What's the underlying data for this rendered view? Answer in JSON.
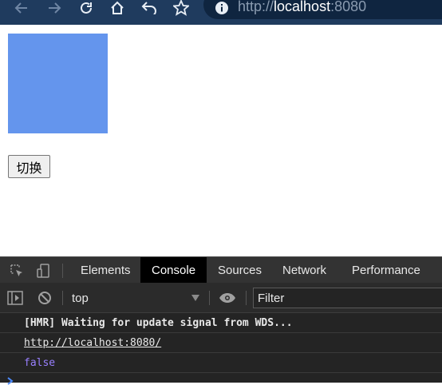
{
  "browser": {
    "url_scheme": "http://",
    "url_host": "localhost",
    "url_port": ":8080",
    "icons": [
      "back-arrow-icon",
      "forward-arrow-icon",
      "reload-icon",
      "home-icon",
      "undo-icon",
      "star-icon",
      "info-icon"
    ]
  },
  "page": {
    "box_color": "#6495ed",
    "toggle_label": "切换"
  },
  "devtools": {
    "tabs": [
      "Elements",
      "Console",
      "Sources",
      "Network",
      "Performance"
    ],
    "active_tab": "Console",
    "context": "top",
    "filter_placeholder": "Filter",
    "logs": [
      "[HMR] Waiting for update signal from WDS...",
      "http://localhost:8080/",
      "false"
    ]
  }
}
